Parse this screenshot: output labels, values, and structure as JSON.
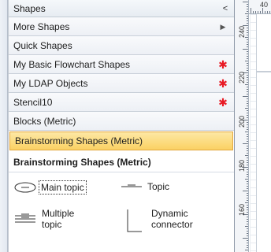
{
  "panel": {
    "title": "Shapes",
    "collapse_glyph": "<"
  },
  "stencils": [
    {
      "label": "More Shapes",
      "marker": "▶"
    },
    {
      "label": "Quick Shapes",
      "marker": ""
    },
    {
      "label": "My Basic Flowchart Shapes",
      "marker": "✱"
    },
    {
      "label": "My LDAP Objects",
      "marker": "✱"
    },
    {
      "label": "Stencil10",
      "marker": "✱"
    },
    {
      "label": "Blocks (Metric)",
      "marker": ""
    },
    {
      "label": "Brainstorming Shapes (Metric)",
      "marker": ""
    }
  ],
  "active_stencil": {
    "title": "Brainstorming Shapes (Metric)",
    "shapes": [
      {
        "name": "Main topic",
        "icon": "ellipse-shape-icon"
      },
      {
        "name": "Topic",
        "icon": "topic-shape-icon"
      },
      {
        "name": "Multiple\ntopic",
        "icon": "multiple-topic-shape-icon"
      },
      {
        "name": "Dynamic\nconnector",
        "icon": "dynamic-connector-icon"
      }
    ]
  },
  "ruler": {
    "vertical_labels": [
      "240",
      "220",
      "200",
      "180",
      "160"
    ],
    "horizontal_labels": [
      "40"
    ]
  },
  "colors": {
    "selected_fill": "#fbd163",
    "selected_border": "#e2a73f",
    "unsaved_marker": "#e81a24"
  }
}
